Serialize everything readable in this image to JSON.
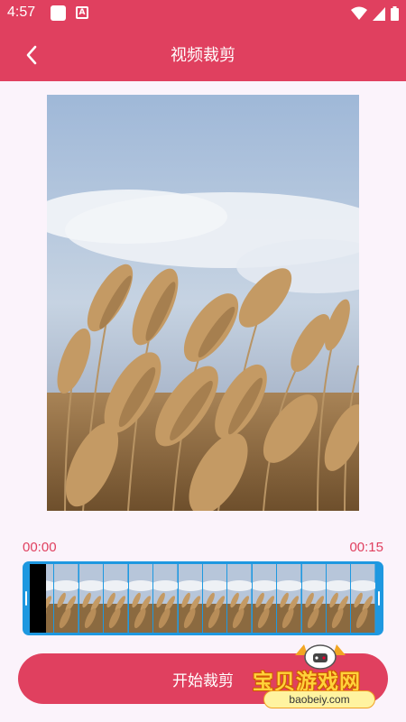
{
  "status_bar": {
    "time": "4:57",
    "badge_letter": "A"
  },
  "header": {
    "title": "视频裁剪"
  },
  "video": {
    "subject": "reeds-sky-preview"
  },
  "trim": {
    "start_time": "00:00",
    "end_time": "00:15",
    "frame_count": 14
  },
  "actions": {
    "start_label": "开始裁剪"
  },
  "watermark": {
    "text": "宝贝游戏网",
    "url": "baobeiy.com"
  },
  "colors": {
    "accent": "#e0405f",
    "strip": "#1e98e0",
    "background": "#fbf3fb"
  }
}
